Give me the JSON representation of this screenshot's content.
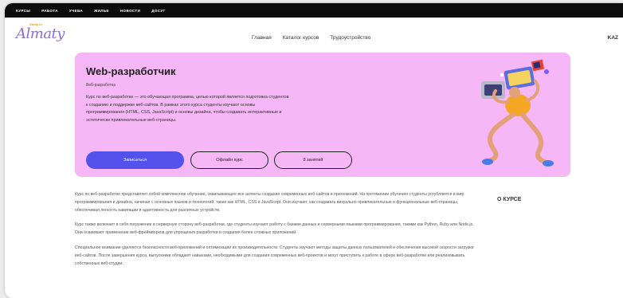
{
  "topbar": {
    "links": [
      "КУРСЫ",
      "РАБОТА",
      "УЧЕБА",
      "ЖИЛЬЕ",
      "НОВОСТИ",
      "ДОСУГ"
    ]
  },
  "header": {
    "logo_text": "Almaty",
    "logo_tag": "Study in",
    "nav": [
      "Главная",
      "Каталог курсов",
      "Трудоустройство"
    ],
    "lang": "KAZ"
  },
  "hero": {
    "title": "Web-разработчик",
    "subtitle": "Веб-разработка",
    "description": "Курс по веб-разработке — это обучающая программа, целью которой является подготовка студентов к созданию и поддержке веб-сайтов. В рамках этого курса студенты изучают основы программирования (HTML, CSS, JavaScript) и основы дизайна, чтобы создавать интерактивные и эстетически привлекательные веб-страницы.",
    "primary_button": "Записаться",
    "offline_button": "Офлайн курс",
    "lessons_button": "8 занятий",
    "colors": {
      "background": "#f5b7f5",
      "primary": "#5352ed"
    }
  },
  "about": {
    "side_title": "О КУРСЕ",
    "paragraphs": [
      "Курс по веб-разработке представляет собой комплексное обучение, охватывающее все аспекты создания современных веб-сайтов и приложений. На протяжении обучения студенты углубляются в мир программирования и дизайна, начиная с основных языков и технологий, таких как HTML, CSS и JavaScript. Они изучают, как создавать визуально привлекательные и функциональные веб-страницы, обеспечивая легкость навигации и адаптивность для различных устройств.",
      "Курс также включает в себя погружение в серверную сторону веб-разработки, где студенты изучают работу с базами данных и серверными языками программирования, такими как Python, Ruby или Node.js. Они осваивают применение веб-фреймворков для упрощения разработки и создания более сложных приложений.",
      "Специальное внимание уделяется безопасности веб-приложений и оптимизации их производительности. Студенты изучают методы защиты данных пользователей и обеспечения высокой скорости загрузки веб-сайтов. После завершения курса, выпускники обладают навыками, необходимыми для создания современных веб-проектов и могут приступить к работе в сфере веб-разработки или реализовывать собственные веб-студии."
    ]
  }
}
